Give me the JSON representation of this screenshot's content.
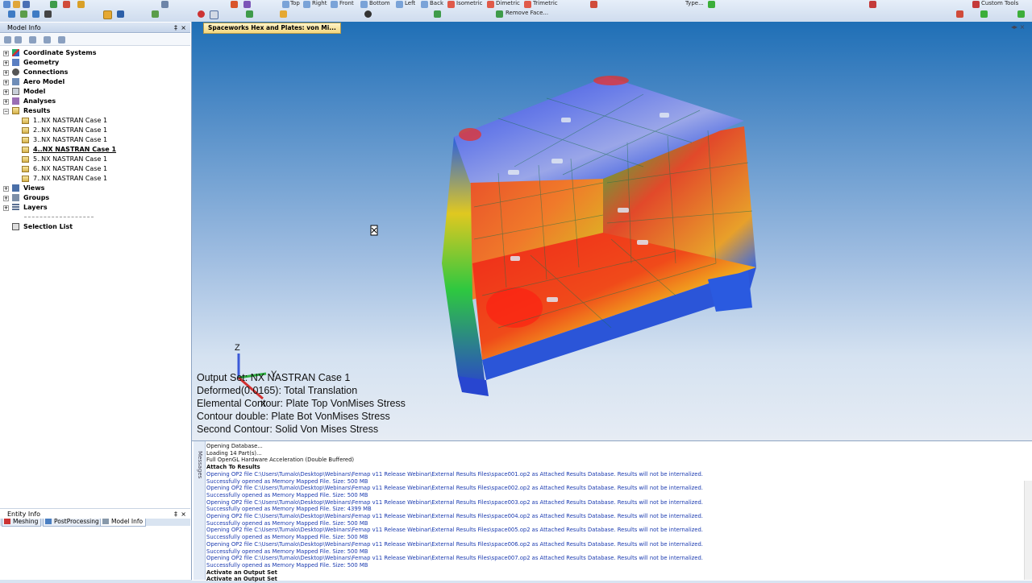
{
  "toolbar": {
    "row1": [
      "Top",
      "Right",
      "Front",
      "Bottom",
      "Left",
      "Back",
      "Isometric",
      "Dimetric",
      "Trimetric",
      "Type...",
      "Custom Tools"
    ],
    "row2": [
      "Remove Face..."
    ]
  },
  "model_info": {
    "title": "Model Info",
    "pin": "‡",
    "close": "×",
    "tree": [
      {
        "label": "Coordinate Systems",
        "expander": "+"
      },
      {
        "label": "Geometry",
        "expander": "+"
      },
      {
        "label": "Connections",
        "expander": "+"
      },
      {
        "label": "Aero Model",
        "expander": "+"
      },
      {
        "label": "Model",
        "expander": "+"
      },
      {
        "label": "Analyses",
        "expander": "+"
      },
      {
        "label": "Results",
        "expander": "−"
      }
    ],
    "results": [
      "1..NX NASTRAN Case 1",
      "2..NX NASTRAN Case 1",
      "3..NX NASTRAN Case 1",
      "4..NX NASTRAN Case 1",
      "5..NX NASTRAN Case 1",
      "6..NX NASTRAN Case 1",
      "7..NX NASTRAN Case 1"
    ],
    "tree2": [
      {
        "label": "Views",
        "expander": "+"
      },
      {
        "label": "Groups",
        "expander": "+"
      },
      {
        "label": "Layers",
        "expander": "+"
      }
    ],
    "selection_list": "Selection List"
  },
  "tabs": [
    "Meshing",
    "PostProcessing",
    "Model Info"
  ],
  "entity_info": {
    "title": "Entity Info",
    "pin": "‡",
    "close": "×"
  },
  "viewport": {
    "tab_title": "Spaceworks Hex and Plates: von Mi...",
    "axis": {
      "z": "Z",
      "y": "Y",
      "x": "X"
    },
    "overlay": [
      "Output Set: NX NASTRAN Case 1",
      "Deformed(0.0165): Total Translation",
      "Elemental Contour: Plate Top VonMises Stress",
      "Contour double: Plate Bot VonMises Stress",
      "Second Contour: Solid Von Mises Stress"
    ]
  },
  "messages": {
    "side_label": "Messages",
    "lines": [
      {
        "text": "Opening Database...",
        "style": "black"
      },
      {
        "text": "Loading 14 Part(s)...",
        "style": "black"
      },
      {
        "text": "Full OpenGL Hardware Acceleration (Double Buffered)",
        "style": "black"
      },
      {
        "text": "Attach To Results",
        "style": "bold"
      },
      {
        "text": "Opening OP2 file C:\\Users\\Tumalo\\Desktop\\Webinars\\Femap v11 Release Webinar\\External Results Files\\space001.op2 as Attached Results Database. Results will not be internalized.",
        "style": "blue"
      },
      {
        "text": "Successfully opened as Memory Mapped File. Size: 500 MB",
        "style": "blue"
      },
      {
        "text": "Opening OP2 file C:\\Users\\Tumalo\\Desktop\\Webinars\\Femap v11 Release Webinar\\External Results Files\\space002.op2 as Attached Results Database. Results will not be internalized.",
        "style": "blue"
      },
      {
        "text": "Successfully opened as Memory Mapped File. Size: 500 MB",
        "style": "blue"
      },
      {
        "text": "Opening OP2 file C:\\Users\\Tumalo\\Desktop\\Webinars\\Femap v11 Release Webinar\\External Results Files\\space003.op2 as Attached Results Database. Results will not be internalized.",
        "style": "blue"
      },
      {
        "text": "Successfully opened as Memory Mapped File. Size: 4399 MB",
        "style": "blue"
      },
      {
        "text": "Opening OP2 file C:\\Users\\Tumalo\\Desktop\\Webinars\\Femap v11 Release Webinar\\External Results Files\\space004.op2 as Attached Results Database. Results will not be internalized.",
        "style": "blue"
      },
      {
        "text": "Successfully opened as Memory Mapped File. Size: 500 MB",
        "style": "blue"
      },
      {
        "text": "Opening OP2 file C:\\Users\\Tumalo\\Desktop\\Webinars\\Femap v11 Release Webinar\\External Results Files\\space005.op2 as Attached Results Database. Results will not be internalized.",
        "style": "blue"
      },
      {
        "text": "Successfully opened as Memory Mapped File. Size: 500 MB",
        "style": "blue"
      },
      {
        "text": "Opening OP2 file C:\\Users\\Tumalo\\Desktop\\Webinars\\Femap v11 Release Webinar\\External Results Files\\space006.op2 as Attached Results Database. Results will not be internalized.",
        "style": "blue"
      },
      {
        "text": "Successfully opened as Memory Mapped File. Size: 500 MB",
        "style": "blue"
      },
      {
        "text": "Opening OP2 file C:\\Users\\Tumalo\\Desktop\\Webinars\\Femap v11 Release Webinar\\External Results Files\\space007.op2 as Attached Results Database. Results will not be internalized.",
        "style": "blue"
      },
      {
        "text": "Successfully opened as Memory Mapped File. Size: 500 MB",
        "style": "blue"
      },
      {
        "text": "Activate an Output Set",
        "style": "bold"
      },
      {
        "text": "Activate an Output Set",
        "style": "bold"
      }
    ]
  }
}
